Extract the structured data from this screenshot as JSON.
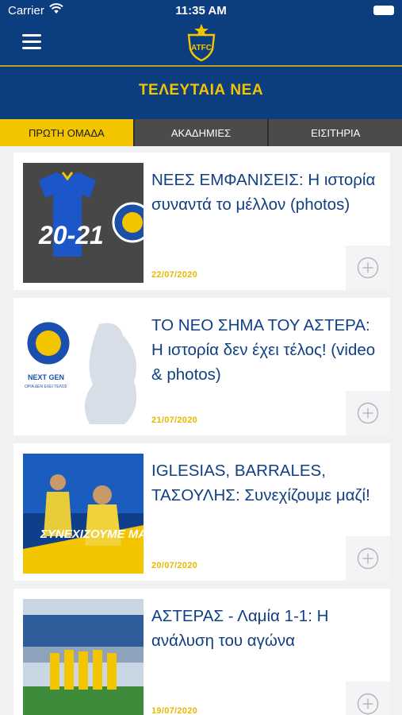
{
  "status_bar": {
    "carrier": "Carrier",
    "time": "11:35 AM"
  },
  "header": {
    "logo_text": "ATFC",
    "title": "ΤΕΛΕΥΤΑΙΑ ΝΕΑ"
  },
  "tabs": [
    {
      "label": "ΠΡΩΤΗ ΟΜΑΔΑ"
    },
    {
      "label": "ΑΚΑΔΗΜΙΕΣ"
    },
    {
      "label": "ΕΙΣΙΤΗΡΙΑ"
    }
  ],
  "news": [
    {
      "title": "ΝΕΕΣ ΕΜΦΑΝΙΣΕΙΣ: Η ιστορία συναντά το μέλλον (photos)",
      "date": "22/07/2020",
      "thumb_text": "20-21"
    },
    {
      "title": "ΤΟ ΝΕΟ ΣΗΜΑ ΤΟΥ ΑΣΤΕΡΑ: Η ιστορία δεν έχει τέλος! (video & photos)",
      "date": "21/07/2020",
      "thumb_text": "NEXT GEN",
      "thumb_subtext": "ΟΡΙΑ ΔΕΝ ΕΧΕΙ ΤΕΛΟΣ"
    },
    {
      "title": "IGLESIAS, BARRALES, ΤΑΣΟΥΛΗΣ: Συνεχίζουμε μαζί!",
      "date": "20/07/2020",
      "thumb_text": "ΣΥΝΕΧΙΖΟΥΜΕ ΜΑΖΙ"
    },
    {
      "title": "ΑΣΤΕΡΑΣ - Λαμία 1-1: Η ανάλυση του αγώνα",
      "date": "19/07/2020"
    }
  ],
  "colors": {
    "brand_blue": "#0b3d7f",
    "brand_yellow": "#f2c500",
    "title_blue": "#113f84"
  },
  "icons": {
    "menu": "hamburger-icon",
    "add": "plus-circle-icon",
    "wifi": "wifi-icon",
    "battery": "battery-icon"
  }
}
